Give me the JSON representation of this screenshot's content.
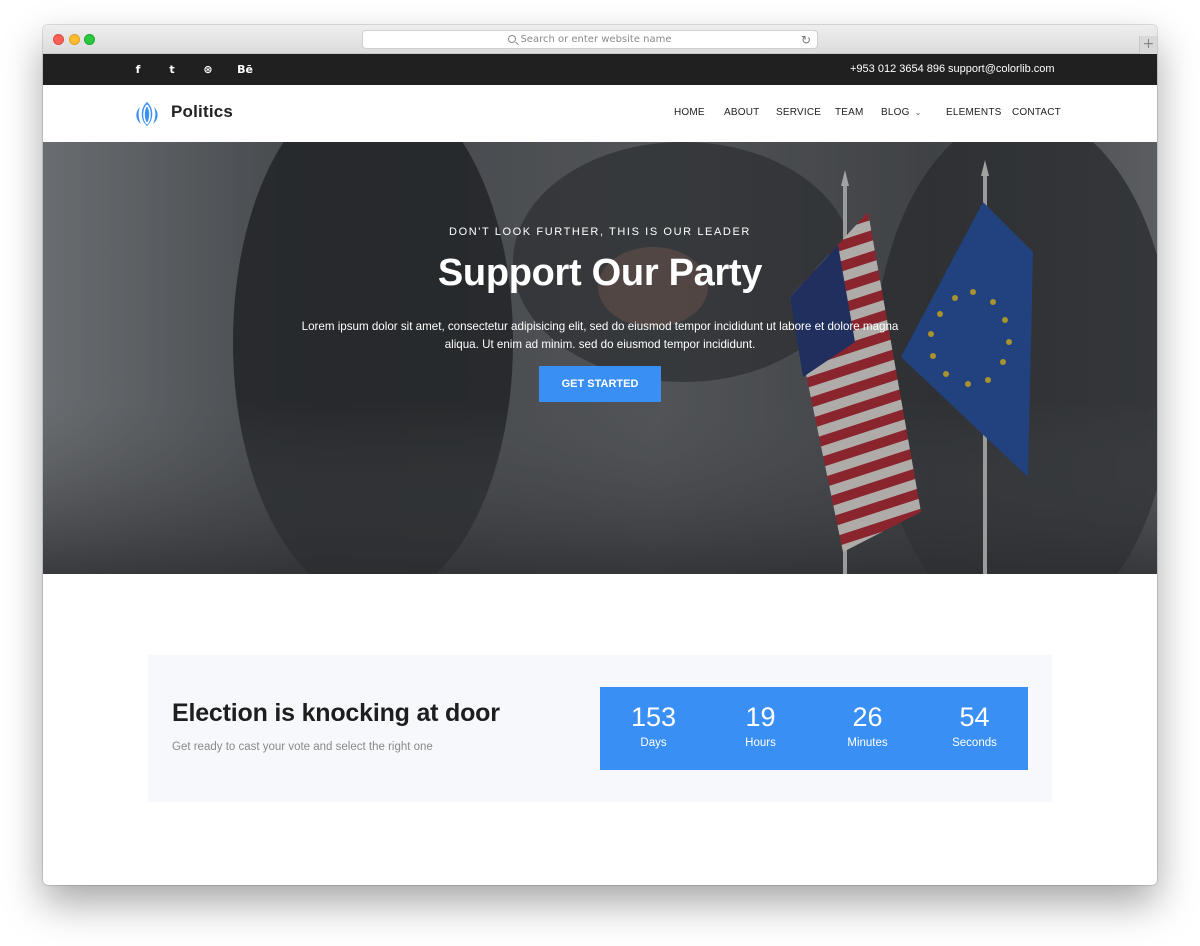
{
  "browser": {
    "url_placeholder": "Search or enter website name",
    "reload_icon": "↻",
    "new_tab_icon": "+"
  },
  "topbar": {
    "social": [
      {
        "name": "facebook-icon",
        "glyph": "f"
      },
      {
        "name": "twitter-icon",
        "glyph": "t"
      },
      {
        "name": "dribbble-icon",
        "glyph": "⊛"
      },
      {
        "name": "behance-icon",
        "glyph": "Bē"
      }
    ],
    "phone": "+953 012 3654 896",
    "email": "support@colorlib.com"
  },
  "nav": {
    "logo": "Politics",
    "items": [
      {
        "label": "HOME"
      },
      {
        "label": "ABOUT"
      },
      {
        "label": "SERVICE"
      },
      {
        "label": "TEAM"
      },
      {
        "label": "BLOG",
        "dropdown": true
      },
      {
        "label": "ELEMENTS"
      },
      {
        "label": "CONTACT"
      }
    ]
  },
  "hero": {
    "eyebrow": "DON'T LOOK FURTHER, THIS IS OUR LEADER",
    "title": "Support Our Party",
    "text": "Lorem ipsum dolor sit amet, consectetur adipisicing elit, sed do eiusmod tempor incididunt ut labore et dolore magna aliqua. Ut enim ad minim. sed do eiusmod tempor incididunt.",
    "button": "GET STARTED"
  },
  "countdown": {
    "title": "Election is knocking at door",
    "subtitle": "Get ready to cast your vote and select the right one",
    "units": [
      {
        "value": "153",
        "label": "Days"
      },
      {
        "value": "19",
        "label": "Hours"
      },
      {
        "value": "26",
        "label": "Minutes"
      },
      {
        "value": "54",
        "label": "Seconds"
      }
    ]
  },
  "colors": {
    "accent": "#3a8ff5",
    "topbar": "#202020",
    "countdown_bg": "#f6f8fc"
  }
}
